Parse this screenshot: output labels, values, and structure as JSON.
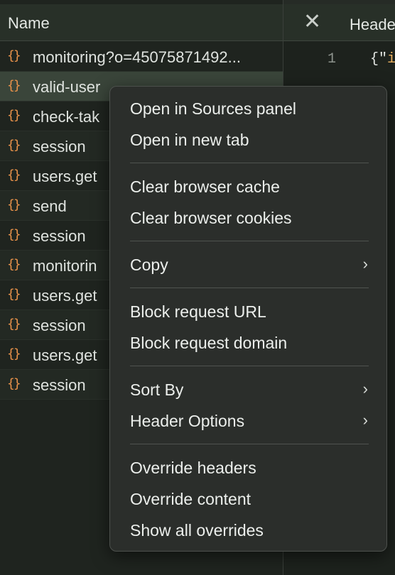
{
  "list": {
    "header_title": "Name",
    "rows": [
      {
        "name": "monitoring?o=45075871492...",
        "icon": "json-icon"
      },
      {
        "name": "valid-user",
        "icon": "json-icon",
        "selected": true
      },
      {
        "name": "check-tak",
        "icon": "json-icon"
      },
      {
        "name": "session",
        "icon": "json-icon"
      },
      {
        "name": "users.get",
        "icon": "json-icon"
      },
      {
        "name": "send",
        "icon": "json-icon"
      },
      {
        "name": "session",
        "icon": "json-icon"
      },
      {
        "name": "monitorin",
        "icon": "json-icon"
      },
      {
        "name": "users.get",
        "icon": "json-icon"
      },
      {
        "name": "session",
        "icon": "json-icon"
      },
      {
        "name": "users.get",
        "icon": "json-icon"
      },
      {
        "name": "session",
        "icon": "json-icon"
      }
    ],
    "row_icon_glyph": "{}"
  },
  "detail": {
    "close_glyph": "✕",
    "tab_label": "Heade",
    "line_number": "1",
    "code_prefix": "{\"",
    "code_key": "i"
  },
  "menu": {
    "items": {
      "open_in_sources": "Open in Sources panel",
      "open_in_new_tab": "Open in new tab",
      "clear_cache": "Clear browser cache",
      "clear_cookies": "Clear browser cookies",
      "copy": "Copy",
      "block_url": "Block request URL",
      "block_domain": "Block request domain",
      "sort_by": "Sort By",
      "header_options": "Header Options",
      "override_headers": "Override headers",
      "override_content": "Override content",
      "show_all_overrides": "Show all overrides"
    },
    "submenu_chevron": "›"
  },
  "colors": {
    "icon_orange": "#e8924a",
    "selected_row": "#3a453a",
    "menu_bg": "#2b2e2b"
  }
}
